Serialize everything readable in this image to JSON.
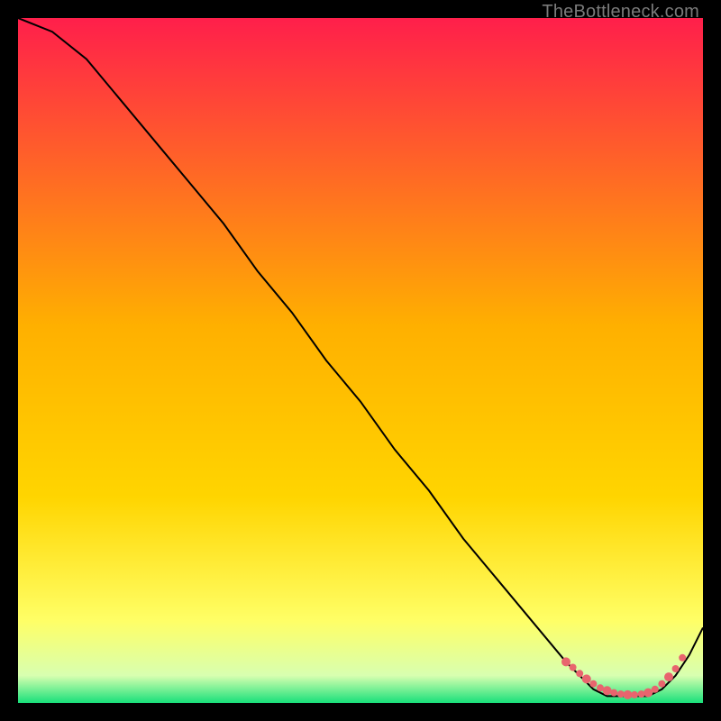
{
  "watermark": "TheBottleneck.com",
  "chart_data": {
    "type": "line",
    "title": "",
    "xlabel": "",
    "ylabel": "",
    "xlim": [
      0,
      100
    ],
    "ylim": [
      0,
      100
    ],
    "grid": false,
    "legend": false,
    "background_gradient": {
      "top_color": "#ff1f4b",
      "mid_color": "#ffd500",
      "lower_color": "#ffff66",
      "bottom_color": "#18e07a"
    },
    "series": [
      {
        "name": "bottleneck-curve",
        "x": [
          0,
          5,
          10,
          15,
          20,
          25,
          30,
          35,
          40,
          45,
          50,
          55,
          60,
          65,
          70,
          75,
          80,
          82,
          84,
          86,
          88,
          90,
          92,
          94,
          96,
          98,
          100
        ],
        "y": [
          100,
          98,
          94,
          88,
          82,
          76,
          70,
          63,
          57,
          50,
          44,
          37,
          31,
          24,
          18,
          12,
          6,
          4,
          2,
          1,
          1,
          1,
          1,
          2,
          4,
          7,
          11
        ]
      }
    ],
    "markers": {
      "name": "highlight-dots",
      "color": "#e8646e",
      "x": [
        80,
        81,
        82,
        83,
        84,
        85,
        86,
        87,
        88,
        89,
        90,
        91,
        92,
        93,
        94,
        95,
        96,
        97
      ],
      "y": [
        6,
        5.2,
        4.3,
        3.5,
        2.8,
        2.2,
        1.8,
        1.5,
        1.3,
        1.2,
        1.2,
        1.3,
        1.5,
        2.0,
        2.8,
        3.8,
        5.0,
        6.6
      ]
    }
  }
}
